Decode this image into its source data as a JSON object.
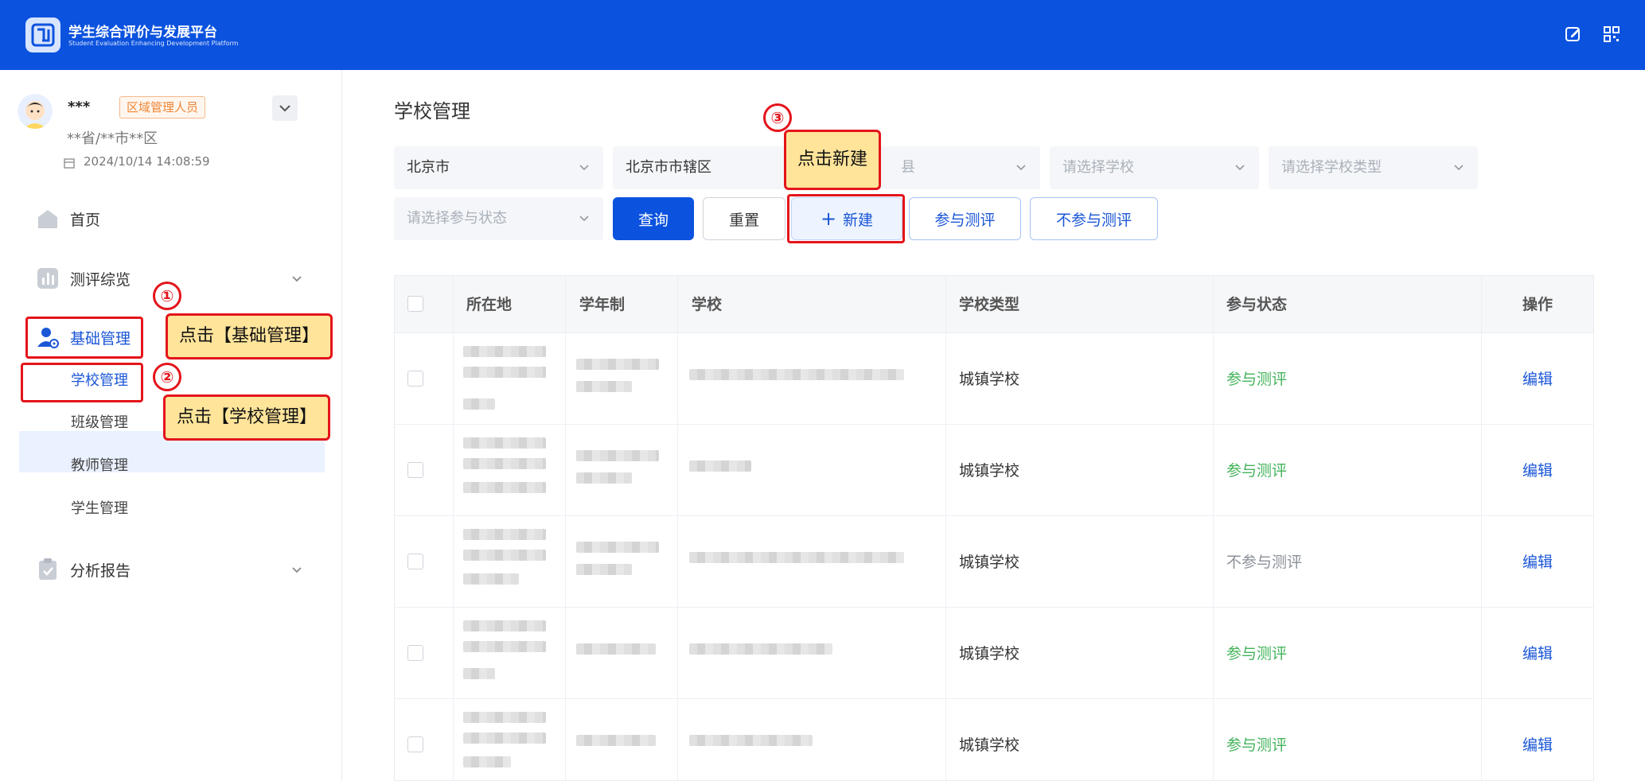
{
  "header": {
    "title": "学生综合评价与发展平台",
    "subtitle": "Student Evaluation Enhancing Development Platform",
    "icons": [
      "edit-icon",
      "qrcode-icon"
    ]
  },
  "user": {
    "name": "***",
    "role": "区域管理人员",
    "region": "**省/**市**区",
    "datetime": "2024/10/14 14:08:59"
  },
  "nav": {
    "home": "首页",
    "overview": "测评综览",
    "basic": "基础管理",
    "sub": [
      "学校管理",
      "班级管理",
      "教师管理",
      "学生管理"
    ],
    "report": "分析报告"
  },
  "page": {
    "title": "学校管理"
  },
  "filters": {
    "province": "北京市",
    "city": "北京市市辖区",
    "county_partial": "县",
    "school_ph": "请选择学校",
    "type_ph": "请选择学校类型",
    "status_ph": "请选择参与状态"
  },
  "buttons": {
    "query": "查询",
    "reset": "重置",
    "new": "新建",
    "new_icon": "+",
    "join": "参与测评",
    "not_join": "不参与测评"
  },
  "table": {
    "headers": [
      "所在地",
      "学年制",
      "学校",
      "学校类型",
      "参与状态",
      "操作"
    ],
    "rows": [
      {
        "type": "城镇学校",
        "status": "参与测评",
        "action": "编辑"
      },
      {
        "type": "城镇学校",
        "status": "参与测评",
        "action": "编辑"
      },
      {
        "type": "城镇学校",
        "status": "不参与测评",
        "action": "编辑"
      },
      {
        "type": "城镇学校",
        "status": "参与测评",
        "action": "编辑"
      },
      {
        "type": "城镇学校",
        "status": "参与测评",
        "action": "编辑"
      }
    ]
  },
  "annotations": {
    "n1": "①",
    "n2": "②",
    "n3": "③",
    "tip1": "点击【基础管理】",
    "tip2": "点击【学校管理】",
    "tip3": "点击新建"
  },
  "colors": {
    "brand": "#0b52de",
    "annotation": "#e4141b",
    "tip_bg": "#ffe49a",
    "success": "#43b35a"
  }
}
